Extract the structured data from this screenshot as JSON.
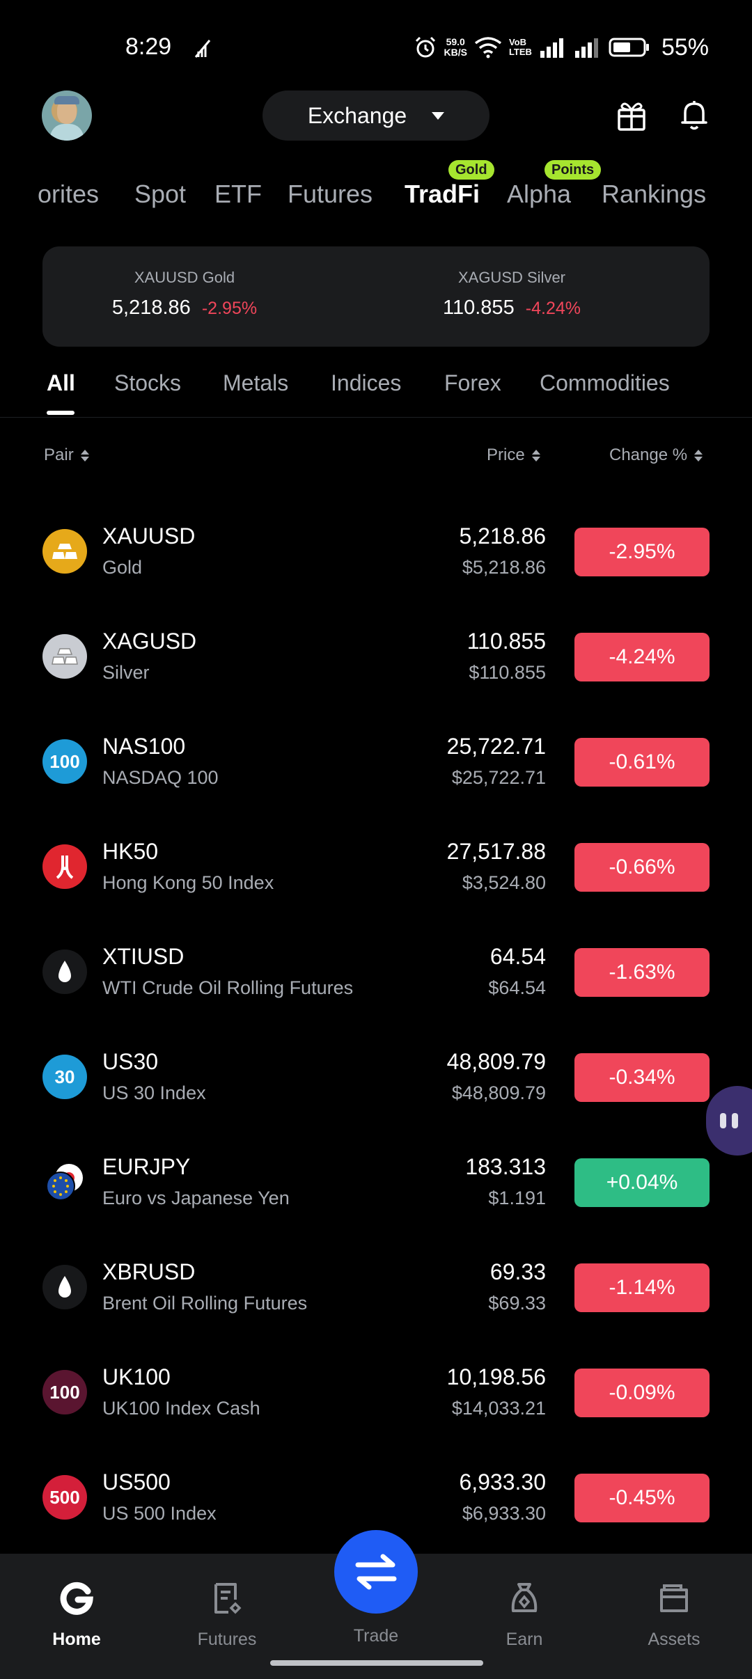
{
  "status_bar": {
    "time": "8:29",
    "net_speed_value": "59.0",
    "net_speed_unit": "KB/S",
    "volte_top": "VoB",
    "volte_bottom": "LTEB",
    "battery_percent": "55%"
  },
  "header": {
    "exchange_label": "Exchange"
  },
  "category_tabs": [
    {
      "label": "orites",
      "active": false
    },
    {
      "label": "Spot",
      "active": false
    },
    {
      "label": "ETF",
      "active": false
    },
    {
      "label": "Futures",
      "active": false
    },
    {
      "label": "TradFi",
      "active": true,
      "badge": "Gold"
    },
    {
      "label": "Alpha",
      "active": false,
      "badge": "Points"
    },
    {
      "label": "Rankings",
      "active": false
    }
  ],
  "ticker": [
    {
      "name": "XAUUSD Gold",
      "price": "5,218.86",
      "change": "-2.95%"
    },
    {
      "name": "XAGUSD Silver",
      "price": "110.855",
      "change": "-4.24%"
    }
  ],
  "sub_tabs": [
    {
      "label": "All",
      "active": true
    },
    {
      "label": "Stocks",
      "active": false
    },
    {
      "label": "Metals",
      "active": false
    },
    {
      "label": "Indices",
      "active": false
    },
    {
      "label": "Forex",
      "active": false
    },
    {
      "label": "Commodities",
      "active": false
    }
  ],
  "columns": {
    "pair": "Pair",
    "price": "Price",
    "change": "Change %"
  },
  "rows": [
    {
      "symbol": "XAUUSD",
      "name": "Gold",
      "price": "5,218.86",
      "usd": "$5,218.86",
      "change": "-2.95%",
      "direction": "down",
      "icon": "gold-bars-icon",
      "icon_text": ""
    },
    {
      "symbol": "XAGUSD",
      "name": "Silver",
      "price": "110.855",
      "usd": "$110.855",
      "change": "-4.24%",
      "direction": "down",
      "icon": "silver-bars-icon",
      "icon_text": ""
    },
    {
      "symbol": "NAS100",
      "name": "NASDAQ 100",
      "price": "25,722.71",
      "usd": "$25,722.71",
      "change": "-0.61%",
      "direction": "down",
      "icon": "nas100-icon",
      "icon_text": "100"
    },
    {
      "symbol": "HK50",
      "name": "Hong Kong 50 Index",
      "price": "27,517.88",
      "usd": "$3,524.80",
      "change": "-0.66%",
      "direction": "down",
      "icon": "hk50-icon",
      "icon_text": ""
    },
    {
      "symbol": "XTIUSD",
      "name": "WTI Crude Oil Rolling Futures",
      "price": "64.54",
      "usd": "$64.54",
      "change": "-1.63%",
      "direction": "down",
      "icon": "oil-drop-icon",
      "icon_text": ""
    },
    {
      "symbol": "US30",
      "name": "US 30 Index",
      "price": "48,809.79",
      "usd": "$48,809.79",
      "change": "-0.34%",
      "direction": "down",
      "icon": "us30-icon",
      "icon_text": "30"
    },
    {
      "symbol": "EURJPY",
      "name": "Euro vs Japanese Yen",
      "price": "183.313",
      "usd": "$1.191",
      "change": "+0.04%",
      "direction": "up",
      "icon": "eurjpy-flags-icon",
      "icon_text": ""
    },
    {
      "symbol": "XBRUSD",
      "name": "Brent Oil Rolling Futures",
      "price": "69.33",
      "usd": "$69.33",
      "change": "-1.14%",
      "direction": "down",
      "icon": "oil-drop-icon",
      "icon_text": ""
    },
    {
      "symbol": "UK100",
      "name": "UK100 Index Cash",
      "price": "10,198.56",
      "usd": "$14,033.21",
      "change": "-0.09%",
      "direction": "down",
      "icon": "uk100-icon",
      "icon_text": "100"
    },
    {
      "symbol": "US500",
      "name": "US 500 Index",
      "price": "6,933.30",
      "usd": "$6,933.30",
      "change": "-0.45%",
      "direction": "down",
      "icon": "us500-icon",
      "icon_text": "500"
    }
  ],
  "bottom_nav": [
    {
      "label": "Home",
      "active": true,
      "icon": "home-icon"
    },
    {
      "label": "Futures",
      "active": false,
      "icon": "futures-icon"
    },
    {
      "label": "Trade",
      "active": false,
      "icon": "swap-arrows-icon"
    },
    {
      "label": "Earn",
      "active": false,
      "icon": "earn-bag-icon"
    },
    {
      "label": "Assets",
      "active": false,
      "icon": "wallet-icon"
    }
  ],
  "colors": {
    "background": "#000000",
    "surface": "#1b1c1e",
    "down": "#f0465a",
    "up": "#2ebd85",
    "accent_blue": "#1f5cf5",
    "badge_green": "#a6e52f",
    "muted_text": "#a9adb4"
  }
}
